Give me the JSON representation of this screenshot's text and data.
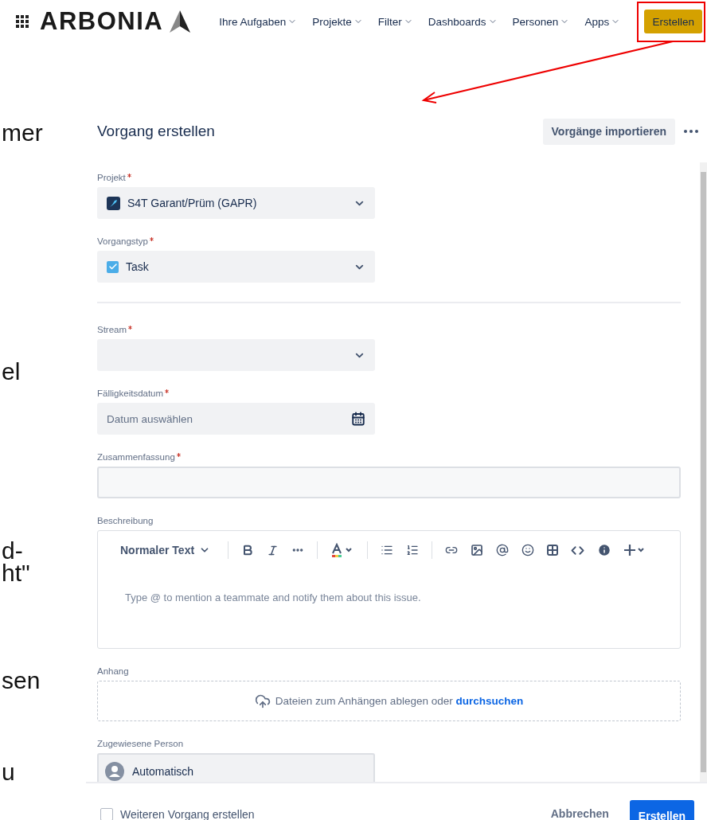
{
  "navbar": {
    "brand": "ARBONIA",
    "menus": [
      {
        "label": "Ihre Aufgaben"
      },
      {
        "label": "Projekte"
      },
      {
        "label": "Filter"
      },
      {
        "label": "Dashboards"
      },
      {
        "label": "Personen"
      },
      {
        "label": "Apps"
      }
    ],
    "create_button": "Erstellen"
  },
  "background_fragments": [
    "mer",
    "el",
    "d-",
    "ht\"",
    "sen",
    "u"
  ],
  "dialog": {
    "title": "Vorgang erstellen",
    "import_button": "Vorgänge importieren",
    "fields": [
      {
        "kind": "select",
        "label": "Projekt",
        "required": true,
        "value": "S4T Garant/Prüm (GAPR)"
      },
      {
        "kind": "select",
        "label": "Vorgangstyp",
        "required": true,
        "value": "Task"
      },
      {
        "kind": "divider"
      },
      {
        "kind": "select",
        "label": "Stream",
        "required": true
      },
      {
        "kind": "date",
        "label": "Fälligkeitsdatum",
        "required": true,
        "placeholder": "Datum auswählen"
      },
      {
        "kind": "text",
        "label": "Zusammenfassung",
        "required": true
      },
      {
        "kind": "editor",
        "label": "Beschreibung",
        "required": false,
        "style": "Normaler Text",
        "placeholder": "Type @ to mention a teammate and notify them about this issue."
      },
      {
        "kind": "attachment",
        "label": "Anhang",
        "required": false,
        "text": "Dateien zum Anhängen ablegen oder",
        "link": "durchsuchen"
      },
      {
        "kind": "person",
        "label": "Zugewiesene Person",
        "required": false,
        "value": "Automatisch"
      }
    ],
    "footer": {
      "checkbox": {
        "label": "Weiteren Vorgang erstellen",
        "checked": false
      },
      "cancel_button": "Abbrechen",
      "submit_button": "Erstellen"
    }
  }
}
